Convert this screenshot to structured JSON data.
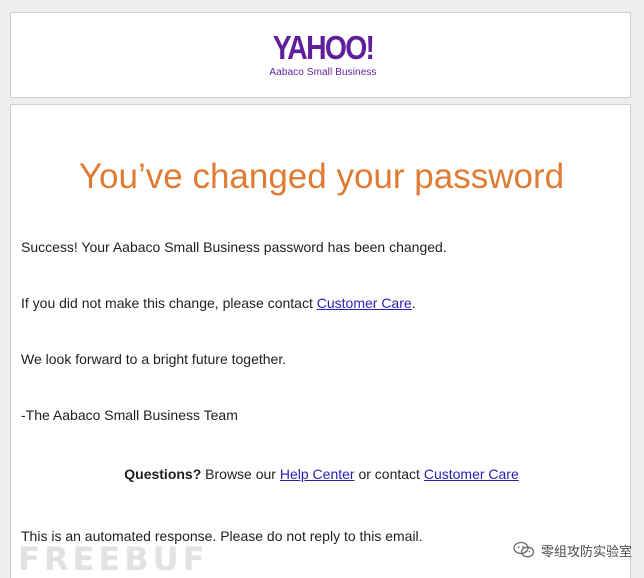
{
  "header": {
    "logo_text": "YAHOO!",
    "logo_subtitle": "Aabaco Small Business"
  },
  "email": {
    "headline": "You’ve changed your password",
    "success_line": "Success! Your Aabaco Small Business password has been changed.",
    "contact_prefix": "If you did not make this change, please contact ",
    "contact_link": "Customer Care",
    "contact_suffix": ".",
    "future_line": "We look forward to a bright future together.",
    "signature": "-The Aabaco Small Business Team",
    "questions_label": "Questions?",
    "questions_browse": " Browse our ",
    "help_center_link": "Help Center",
    "questions_or": " or contact ",
    "questions_customer_care": "Customer Care",
    "automated_notice": "This is an automated response. Please do not reply to this email."
  },
  "watermarks": {
    "left": "FREEBUF",
    "right": "零组攻防实验室"
  },
  "colors": {
    "brand_purple": "#5f1f9c",
    "headline_orange": "#e07b33",
    "link_blue": "#2a1fb4"
  }
}
